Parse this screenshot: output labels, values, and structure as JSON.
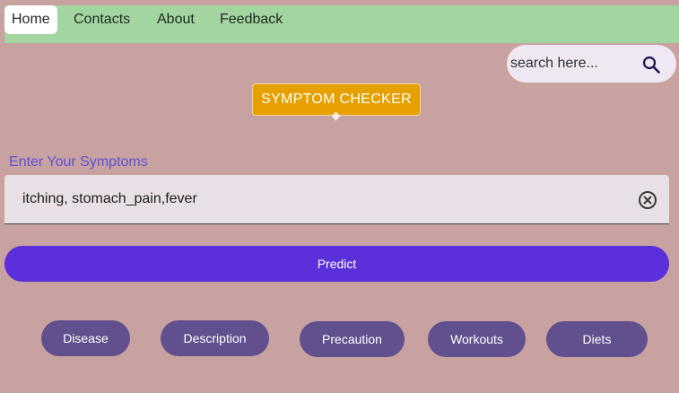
{
  "nav": {
    "items": [
      {
        "label": "Home",
        "active": true
      },
      {
        "label": "Contacts"
      },
      {
        "label": "About"
      },
      {
        "label": "Feedback"
      }
    ]
  },
  "search": {
    "placeholder": "search here...",
    "icon": "search-icon"
  },
  "badge": {
    "label": "SYMPTOM CHECKER",
    "color": "#e6a000"
  },
  "symptoms": {
    "label": "Enter Your Symptoms",
    "value": "itching, stomach_pain,fever",
    "clear_icon": "clear-icon"
  },
  "predict": {
    "label": "Predict",
    "color": "#5b2fd9"
  },
  "results": {
    "buttons": [
      {
        "label": "Disease"
      },
      {
        "label": "Description"
      },
      {
        "label": "Precaution"
      },
      {
        "label": "Workouts"
      },
      {
        "label": "Diets"
      }
    ],
    "color": "#62508e"
  },
  "colors": {
    "background": "#c8a2a0",
    "navbar": "#a2d5a0",
    "label_accent": "#6050d8"
  }
}
